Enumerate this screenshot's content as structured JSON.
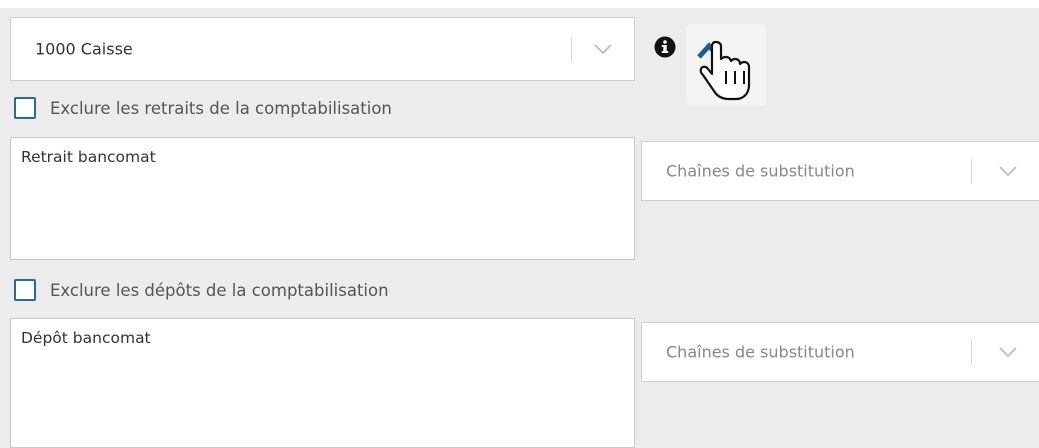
{
  "account_select": {
    "value": "1000 Caisse"
  },
  "withdrawals": {
    "exclude_label": "Exclure les retraits de la comptabilisation",
    "text": "Retrait bancomat",
    "substitution_placeholder": "Chaînes de substitution"
  },
  "deposits": {
    "exclude_label": "Exclure les dépôts de la comptabilisation",
    "text": "Dépôt bancomat",
    "substitution_placeholder": "Chaînes de substitution"
  },
  "icons": {
    "info": "info-icon",
    "collapse": "chevron-up-icon",
    "cursor": "hand-pointer-cursor",
    "dropdown": "chevron-down-icon"
  },
  "colors": {
    "accent": "#2b6a96",
    "chevron_up": "#1e5f86",
    "background": "#ececec"
  }
}
